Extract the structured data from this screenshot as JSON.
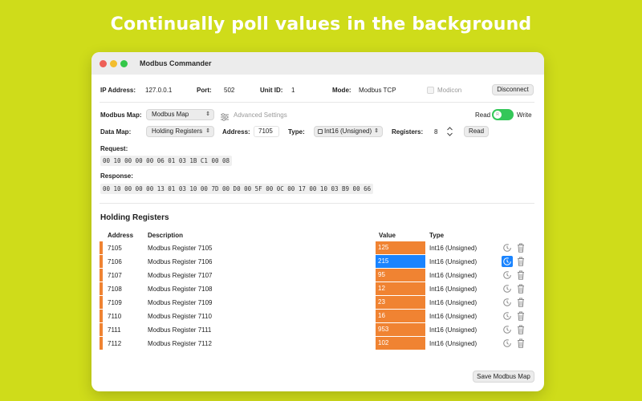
{
  "headline": "Continually poll values in the background",
  "window": {
    "title": "Modbus Commander"
  },
  "connection": {
    "ip_label": "IP Address:",
    "ip_value": "127.0.0.1",
    "port_label": "Port:",
    "port_value": "502",
    "unit_label": "Unit ID:",
    "unit_value": "1",
    "mode_label": "Mode:",
    "mode_value": "Modbus TCP",
    "modicon_label": "Modicon",
    "disconnect_label": "Disconnect"
  },
  "config": {
    "map_label": "Modbus Map:",
    "map_value": "Modbus Map",
    "advanced_label": "Advanced Settings",
    "read_label": "Read",
    "write_label": "Write",
    "toggle_knob": "R",
    "data_map_label": "Data Map:",
    "data_map_value": "Holding Registers",
    "address_label": "Address:",
    "address_value": "7105",
    "type_label": "Type:",
    "type_value": "Int16 (Unsigned)",
    "registers_label": "Registers:",
    "registers_value": "8",
    "read_button": "Read"
  },
  "request": {
    "label": "Request:",
    "hex": "00 10 00 00 00 06 01 03 1B C1 00 08"
  },
  "response": {
    "label": "Response:",
    "hex": "00 10 00 00 00 13 01 03 10 00 7D 00 D0 00 5F 00 0C 00 17 00 10 03 B9 00 66"
  },
  "table": {
    "title": "Holding Registers",
    "headers": {
      "address": "Address",
      "description": "Description",
      "value": "Value",
      "type": "Type"
    },
    "rows": [
      {
        "address": "7105",
        "description": "Modbus Register 7105",
        "value": "125",
        "type": "Int16 (Unsigned)"
      },
      {
        "address": "7106",
        "description": "Modbus Register 7106",
        "value": "215",
        "type": "Int16 (Unsigned)"
      },
      {
        "address": "7107",
        "description": "Modbus Register 7107",
        "value": "95",
        "type": "Int16 (Unsigned)"
      },
      {
        "address": "7108",
        "description": "Modbus Register 7108",
        "value": "12",
        "type": "Int16 (Unsigned)"
      },
      {
        "address": "7109",
        "description": "Modbus Register 7109",
        "value": "23",
        "type": "Int16 (Unsigned)"
      },
      {
        "address": "7110",
        "description": "Modbus Register 7110",
        "value": "16",
        "type": "Int16 (Unsigned)"
      },
      {
        "address": "7111",
        "description": "Modbus Register 7111",
        "value": "953",
        "type": "Int16 (Unsigned)"
      },
      {
        "address": "7112",
        "description": "Modbus Register 7112",
        "value": "102",
        "type": "Int16 (Unsigned)"
      }
    ]
  },
  "footer": {
    "save_label": "Save Modbus Map"
  },
  "colors": {
    "background": "#cfdc1a",
    "value_cell": "#f08332",
    "selected_value_cell": "#1a84ff",
    "toggle_on": "#34c759"
  },
  "icons": {
    "advanced": "sliders-icon",
    "poll": "poll-timer-icon",
    "delete": "trash-icon",
    "type_popup": "number-type-icon"
  }
}
